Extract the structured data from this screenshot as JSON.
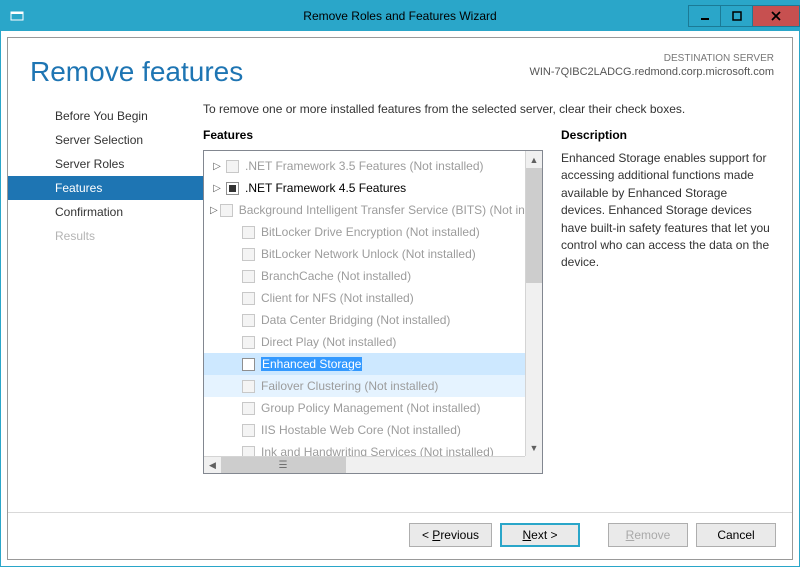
{
  "window": {
    "title": "Remove Roles and Features Wizard"
  },
  "header": {
    "page_title": "Remove features",
    "dest_label": "DESTINATION SERVER",
    "dest_value": "WIN-7QIBC2LADCG.redmond.corp.microsoft.com"
  },
  "nav": {
    "items": [
      {
        "label": "Before You Begin",
        "state": "normal"
      },
      {
        "label": "Server Selection",
        "state": "normal"
      },
      {
        "label": "Server Roles",
        "state": "normal"
      },
      {
        "label": "Features",
        "state": "selected"
      },
      {
        "label": "Confirmation",
        "state": "normal"
      },
      {
        "label": "Results",
        "state": "disabled"
      }
    ]
  },
  "main": {
    "instruction": "To remove one or more installed features from the selected server, clear their check boxes.",
    "features_heading": "Features",
    "description_heading": "Description",
    "description_text": "Enhanced Storage enables support for accessing additional functions made available by Enhanced Storage devices. Enhanced Storage devices have built-in safety features that let you control who can access the data on the device."
  },
  "features": [
    {
      "label": ".NET Framework 3.5 Features (Not installed)",
      "enabled": false,
      "expander": "▷",
      "check": "empty"
    },
    {
      "label": ".NET Framework 4.5 Features",
      "enabled": true,
      "expander": "▷",
      "check": "filled"
    },
    {
      "label": "Background Intelligent Transfer Service (BITS) (Not installed)",
      "enabled": false,
      "expander": "▷",
      "check": "empty"
    },
    {
      "label": "BitLocker Drive Encryption (Not installed)",
      "enabled": false,
      "expander": "",
      "check": "empty",
      "indent": true
    },
    {
      "label": "BitLocker Network Unlock (Not installed)",
      "enabled": false,
      "expander": "",
      "check": "empty",
      "indent": true
    },
    {
      "label": "BranchCache (Not installed)",
      "enabled": false,
      "expander": "",
      "check": "empty",
      "indent": true
    },
    {
      "label": "Client for NFS (Not installed)",
      "enabled": false,
      "expander": "",
      "check": "empty",
      "indent": true
    },
    {
      "label": "Data Center Bridging (Not installed)",
      "enabled": false,
      "expander": "",
      "check": "empty",
      "indent": true
    },
    {
      "label": "Direct Play (Not installed)",
      "enabled": false,
      "expander": "",
      "check": "empty",
      "indent": true
    },
    {
      "label": "Enhanced Storage",
      "enabled": true,
      "expander": "",
      "check": "empty",
      "indent": true,
      "selected": true
    },
    {
      "label": "Failover Clustering (Not installed)",
      "enabled": false,
      "expander": "",
      "check": "empty",
      "indent": true,
      "hover": true
    },
    {
      "label": "Group Policy Management (Not installed)",
      "enabled": false,
      "expander": "",
      "check": "empty",
      "indent": true
    },
    {
      "label": "IIS Hostable Web Core (Not installed)",
      "enabled": false,
      "expander": "",
      "check": "empty",
      "indent": true
    },
    {
      "label": "Ink and Handwriting Services (Not installed)",
      "enabled": false,
      "expander": "",
      "check": "empty",
      "indent": true
    }
  ],
  "footer": {
    "prev_pre": "< ",
    "prev_u": "P",
    "prev_post": "revious",
    "next_u": "N",
    "next_post": "ext >",
    "remove_u": "R",
    "remove_post": "emove",
    "cancel": "Cancel"
  }
}
